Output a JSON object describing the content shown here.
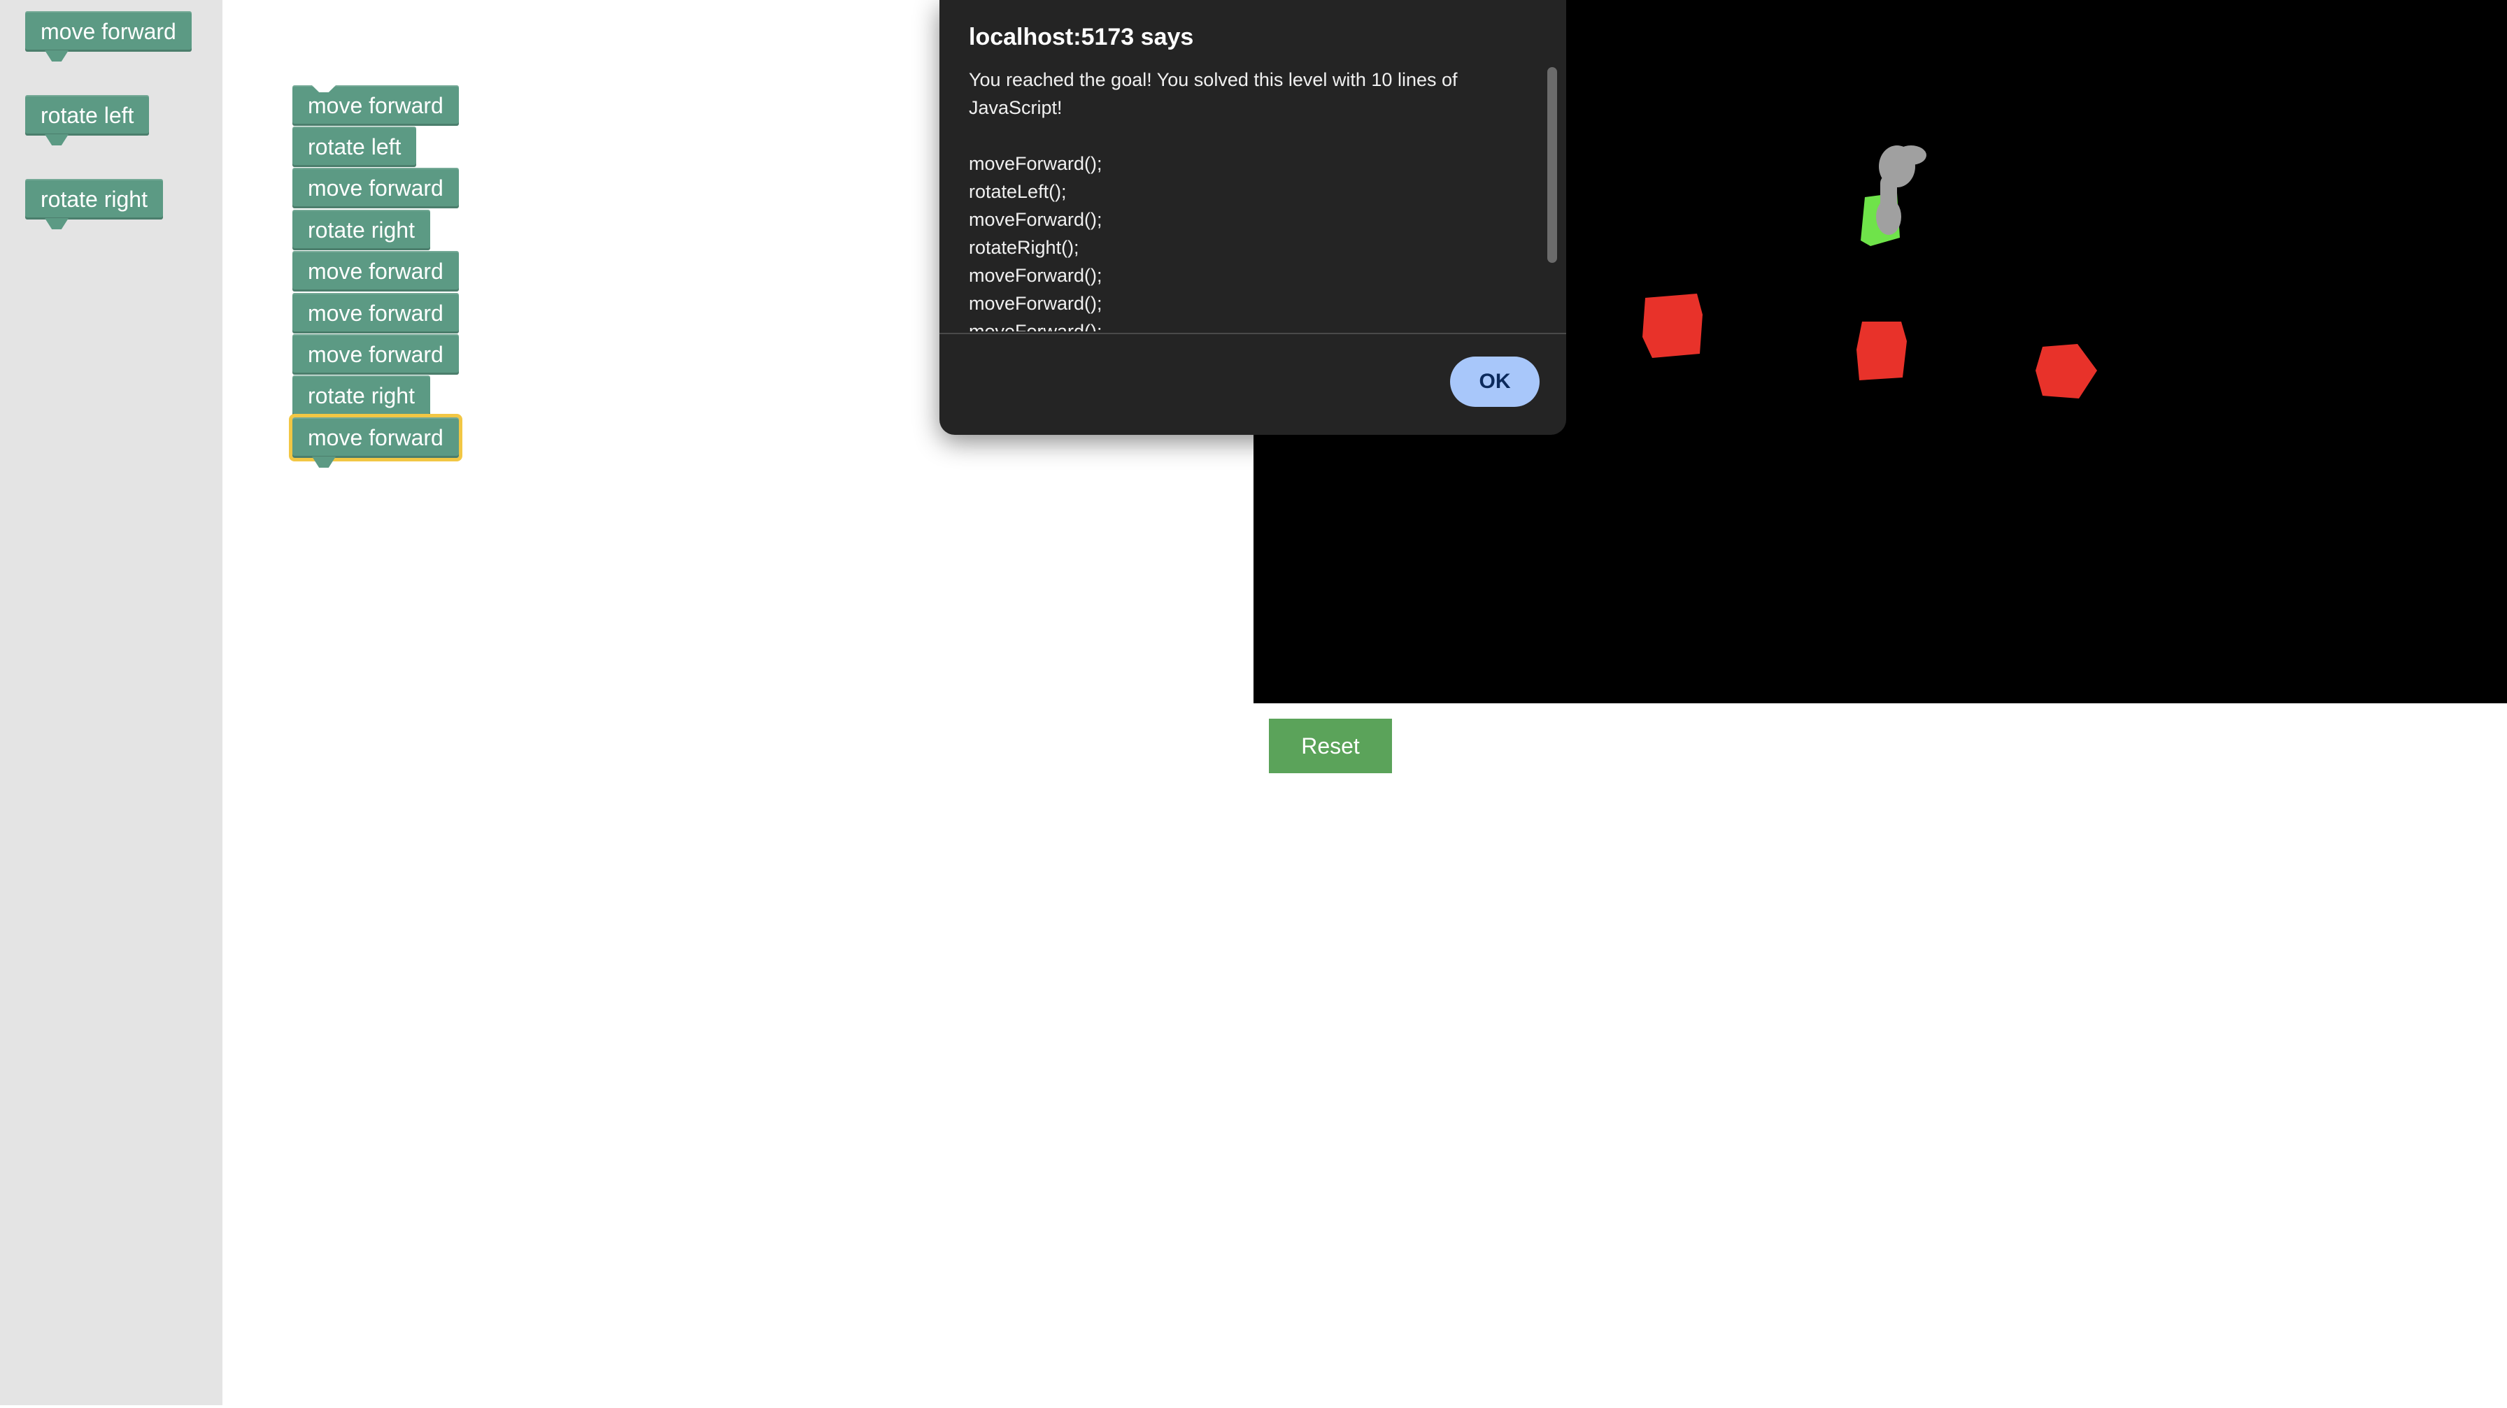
{
  "toolbox": {
    "blocks": [
      {
        "label": "move forward"
      },
      {
        "label": "rotate left"
      },
      {
        "label": "rotate right"
      }
    ]
  },
  "workspace": {
    "blocks": [
      {
        "label": "move forward"
      },
      {
        "label": "rotate left"
      },
      {
        "label": "move forward"
      },
      {
        "label": "rotate right"
      },
      {
        "label": "move forward"
      },
      {
        "label": "move forward"
      },
      {
        "label": "move forward"
      },
      {
        "label": "rotate right"
      },
      {
        "label": "move forward",
        "selected": true
      }
    ]
  },
  "dialog": {
    "title": "localhost:5173 says",
    "message_line1": "You reached the goal! You solved this level with 10 lines of",
    "message_line2": "JavaScript!",
    "code_lines": [
      "moveForward();",
      "rotateLeft();",
      "moveForward();",
      "rotateRight();",
      "moveForward();",
      "moveForward();",
      "moveForward();"
    ],
    "ok_label": "OK"
  },
  "controls": {
    "reset_label": "Reset"
  },
  "colors": {
    "block": "#5c9a84",
    "selected_outline": "#f2c744",
    "stage_bg": "#000000",
    "obstacle": "#e8322a",
    "goal": "#6fe34a",
    "robot": "#a0a0a0",
    "reset_button": "#5ba35a",
    "ok_button": "#a8c7fa"
  }
}
